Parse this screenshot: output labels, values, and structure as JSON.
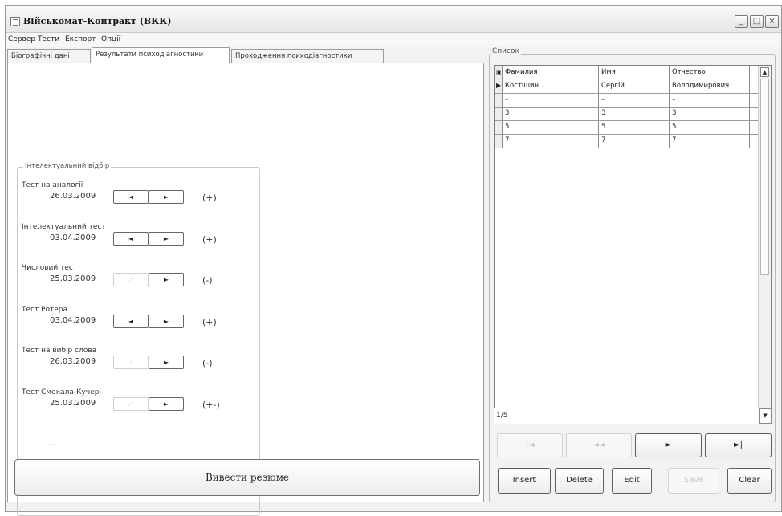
{
  "window": {
    "title": "Військомат-Контракт (ВКК)",
    "controls": [
      "_",
      "□",
      "×"
    ]
  },
  "menu": [
    "Сервер",
    "Тести",
    "Експорт",
    "Опції"
  ],
  "tabs": [
    {
      "label": "Біографічні дані",
      "active": false
    },
    {
      "label": "Результати психодіагностики",
      "active": true
    },
    {
      "label": "Проходження психодіагностики",
      "active": false
    }
  ],
  "group": {
    "legend": "Інтелектуальний відбір",
    "tests": [
      {
        "name": "Тест на аналогії",
        "date": "26.03.2009",
        "result": "(+)",
        "prev_enabled": true
      },
      {
        "name": "Інтелектуальний тест",
        "date": "03.04.2009",
        "result": "(+)",
        "prev_enabled": true
      },
      {
        "name": "Числовий тест",
        "date": "25.03.2009",
        "result": "(-)",
        "prev_enabled": false
      },
      {
        "name": "Тест Ротера",
        "date": "03.04.2009",
        "result": "(+)",
        "prev_enabled": true
      },
      {
        "name": "Тест на вибір слова",
        "date": "26.03.2009",
        "result": "(-)",
        "prev_enabled": false
      },
      {
        "name": "Тест Смекала-Кучері",
        "date": "25.03.2009",
        "result": "(+-)",
        "prev_enabled": false
      }
    ],
    "ellipsis": "....",
    "nav_prev": "◄",
    "nav_next": "►",
    "nav_prev_disabled": "⟋"
  },
  "resume_button": "Вивести резюме",
  "list": {
    "legend": "Список",
    "columns": [
      "Фамилия",
      "Имя",
      "Отчество"
    ],
    "rows": [
      [
        "Костішин",
        "Сергій",
        "Володимирович"
      ],
      [
        "–",
        "–",
        "–"
      ],
      [
        "3",
        "3",
        "3"
      ],
      [
        "5",
        "5",
        "5"
      ],
      [
        "7",
        "7",
        "7"
      ]
    ],
    "current_row_marker": "▶",
    "status": "1/5"
  },
  "nav_buttons": {
    "first": "|◄",
    "prev": "◄◄",
    "next": "►",
    "last": "►|"
  },
  "action_buttons": {
    "insert": "Insert",
    "delete": "Delete",
    "edit": "Edit",
    "save": "Save",
    "clear": "Clear"
  }
}
